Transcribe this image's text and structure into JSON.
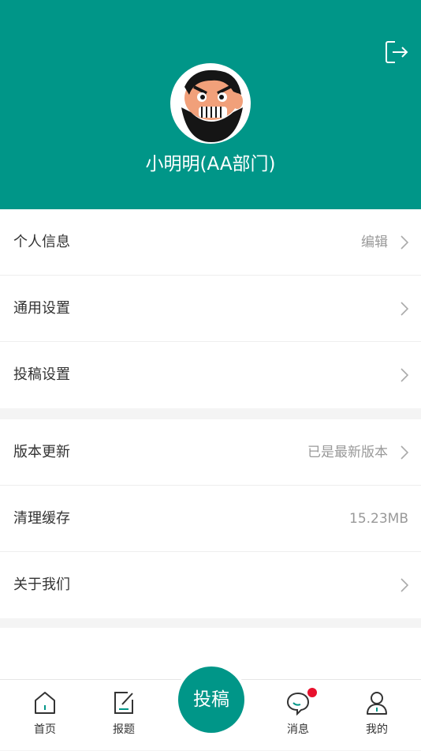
{
  "header": {
    "username": "小明明(AA部门)"
  },
  "group1": [
    {
      "label": "个人信息",
      "value": "编辑",
      "chevron": true
    },
    {
      "label": "通用设置",
      "value": "",
      "chevron": true
    },
    {
      "label": "投稿设置",
      "value": "",
      "chevron": true
    }
  ],
  "group2": [
    {
      "label": "版本更新",
      "value": "已是最新版本",
      "chevron": true
    },
    {
      "label": "清理缓存",
      "value": "15.23MB",
      "chevron": false
    },
    {
      "label": "关于我们",
      "value": "",
      "chevron": true
    }
  ],
  "tabbar": {
    "home": "首页",
    "report": "报题",
    "submit": "投稿",
    "messages": "消息",
    "mine": "我的"
  },
  "colors": {
    "accent": "#009688",
    "badge": "#e8112d"
  },
  "icons": [
    "logout-icon",
    "home-icon",
    "edit-icon",
    "message-icon",
    "user-icon",
    "chevron-right-icon"
  ]
}
